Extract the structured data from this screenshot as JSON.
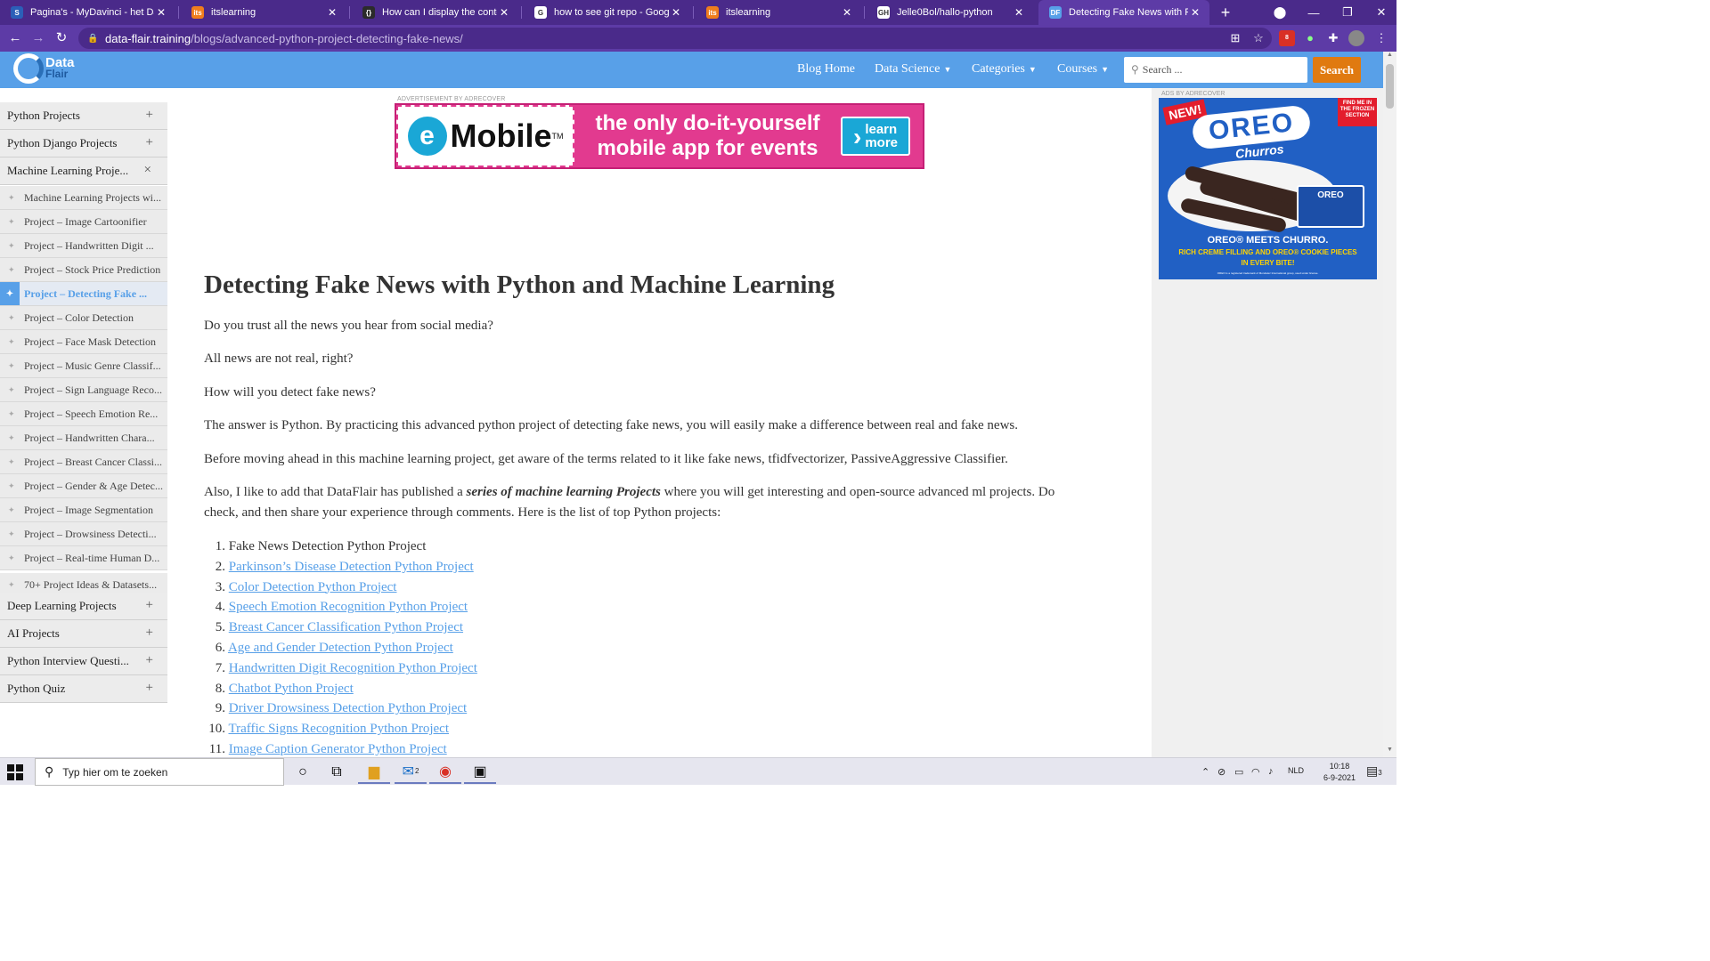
{
  "browser": {
    "tabs": [
      {
        "title": "Pagina's - MyDavinci - het Da Vi",
        "icon": "S",
        "icon_color": "#2b5fb8",
        "active": false
      },
      {
        "title": "itslearning",
        "icon": "its",
        "icon_color": "#f07d1c",
        "active": false
      },
      {
        "title": "How can I display the contents o",
        "icon": "{}",
        "icon_color": "#2b2b2b",
        "active": false
      },
      {
        "title": "how to see git repo - Google zo",
        "icon": "G",
        "icon_color": "#ffffff",
        "active": false
      },
      {
        "title": "itslearning",
        "icon": "its",
        "icon_color": "#f07d1c",
        "active": false
      },
      {
        "title": "Jelle0Bol/hallo-python",
        "icon": "GH",
        "icon_color": "#ffffff",
        "active": false
      },
      {
        "title": "Detecting Fake News with Pytho",
        "icon": "DF",
        "icon_color": "#58a0e8",
        "active": true
      }
    ],
    "new_tab": "+",
    "url_host": "data-flair.training",
    "url_path": "/blogs/advanced-python-project-detecting-fake-news/",
    "extension_badge": "8"
  },
  "site": {
    "logo_line1": "Data",
    "logo_line2": "Flair",
    "menu": [
      {
        "label": "Blog Home",
        "dropdown": false
      },
      {
        "label": "Data Science",
        "dropdown": true
      },
      {
        "label": "Categories",
        "dropdown": true
      },
      {
        "label": "Courses",
        "dropdown": true
      }
    ],
    "search_placeholder": "Search ...",
    "search_button": "Search",
    "brand_color": "#58a0e8",
    "accent_color": "#e07a10"
  },
  "sidebar": {
    "sections_top": [
      {
        "label": "Python Projects",
        "toggle": "+"
      },
      {
        "label": "Python Django Projects",
        "toggle": "+"
      },
      {
        "label": "Machine Learning Proje...",
        "toggle": "×"
      }
    ],
    "sub_items": [
      {
        "label": "Machine Learning Projects wi...",
        "active": false
      },
      {
        "label": "Project – Image Cartoonifier",
        "active": false
      },
      {
        "label": "Project – Handwritten Digit ...",
        "active": false
      },
      {
        "label": "Project – Stock Price Prediction",
        "active": false
      },
      {
        "label": "Project – Detecting Fake ...",
        "active": true
      },
      {
        "label": "Project – Color Detection",
        "active": false
      },
      {
        "label": "Project – Face Mask Detection",
        "active": false
      },
      {
        "label": "Project – Music Genre Classif...",
        "active": false
      },
      {
        "label": "Project – Sign Language Reco...",
        "active": false
      },
      {
        "label": "Project – Speech Emotion Re...",
        "active": false
      },
      {
        "label": "Project – Handwritten Chara...",
        "active": false
      },
      {
        "label": "Project – Breast Cancer Classi...",
        "active": false
      },
      {
        "label": "Project – Gender & Age Detec...",
        "active": false
      },
      {
        "label": "Project – Image Segmentation",
        "active": false
      },
      {
        "label": "Project – Drowsiness Detecti...",
        "active": false
      },
      {
        "label": "Project – Real-time Human D...",
        "active": false
      },
      {
        "label": "70+ Project Ideas & Datasets...",
        "active": false
      }
    ],
    "sections_bottom": [
      {
        "label": "Deep Learning Projects",
        "toggle": "+"
      },
      {
        "label": "AI Projects",
        "toggle": "+"
      },
      {
        "label": "Python Interview Questi...",
        "toggle": "+"
      },
      {
        "label": "Python Quiz",
        "toggle": "+"
      }
    ]
  },
  "main": {
    "ad_label": "ADVERTISEMENT BY ADRECOVER",
    "banner": {
      "brand_letter": "e",
      "brand": "Mobile",
      "tm": "TM",
      "tagline_1": "the only do-it-yourself",
      "tagline_2": "mobile app for events",
      "cta_1": "learn",
      "cta_2": "more"
    },
    "title": "Detecting Fake News with Python and Machine Learning",
    "paragraphs": [
      "Do you trust all the news you hear from social media?",
      "All news are not real, right?",
      "How will you detect fake news?",
      "The answer is Python. By practicing this advanced python project of detecting fake news, you will easily make a difference between real and fake news.",
      "Before moving ahead in this machine learning project, get aware of the terms related to it like fake news, tfidfvectorizer, PassiveAggressive Classifier."
    ],
    "para6_before": "Also, I like to add that DataFlair has published a ",
    "para6_bold": "series of machine learning Projects",
    "para6_after": " where you will get interesting and open-source advanced ml projects. Do check, and then share your experience through comments. Here is the list of top Python projects:",
    "list": [
      {
        "num": "1.",
        "text": "Fake News Detection Python Project",
        "link": false
      },
      {
        "num": "2.",
        "text": "Parkinson’s Disease Detection Python Project",
        "link": true
      },
      {
        "num": "3.",
        "text": "Color Detection Python Project",
        "link": true
      },
      {
        "num": "4.",
        "text": "Speech Emotion Recognition Python Project ",
        "link": true
      },
      {
        "num": "5.",
        "text": "Breast Cancer Classification Python Project",
        "link": true
      },
      {
        "num": "6.",
        "text": "Age and Gender Detection Python Project ",
        "link": true
      },
      {
        "num": "7.",
        "text": "Handwritten Digit Recognition Python Project",
        "link": true
      },
      {
        "num": "8.",
        "text": "Chatbot Python Project",
        "link": true
      },
      {
        "num": "9.",
        "text": "Driver Drowsiness Detection Python Project",
        "link": true
      },
      {
        "num": "10.",
        "text": "Traffic Signs Recognition Python Project",
        "link": true
      },
      {
        "num": "11.",
        "text": "Image Caption Generator Python Project",
        "link": true
      }
    ]
  },
  "right_ad": {
    "label": "ADS BY ADRECOVER",
    "new": "NEW!",
    "corner": "FIND ME IN THE FROZEN SECTION",
    "brand": "OREO",
    "sub": "Churros",
    "pkg": "OREO",
    "line1": "OREO® MEETS CHURRO.",
    "line2a": "RICH CREME FILLING AND OREO® COOKIE PIECES",
    "line2b": "IN EVERY BITE!",
    "fine": "OREO is a registered trademark of Mondelez International group, used under license."
  },
  "taskbar": {
    "search_placeholder": "Typ hier om te zoeken",
    "mail_badge": "2",
    "language": "NLD",
    "time": "10:18",
    "date": "6-9-2021",
    "notif_count": "3"
  }
}
